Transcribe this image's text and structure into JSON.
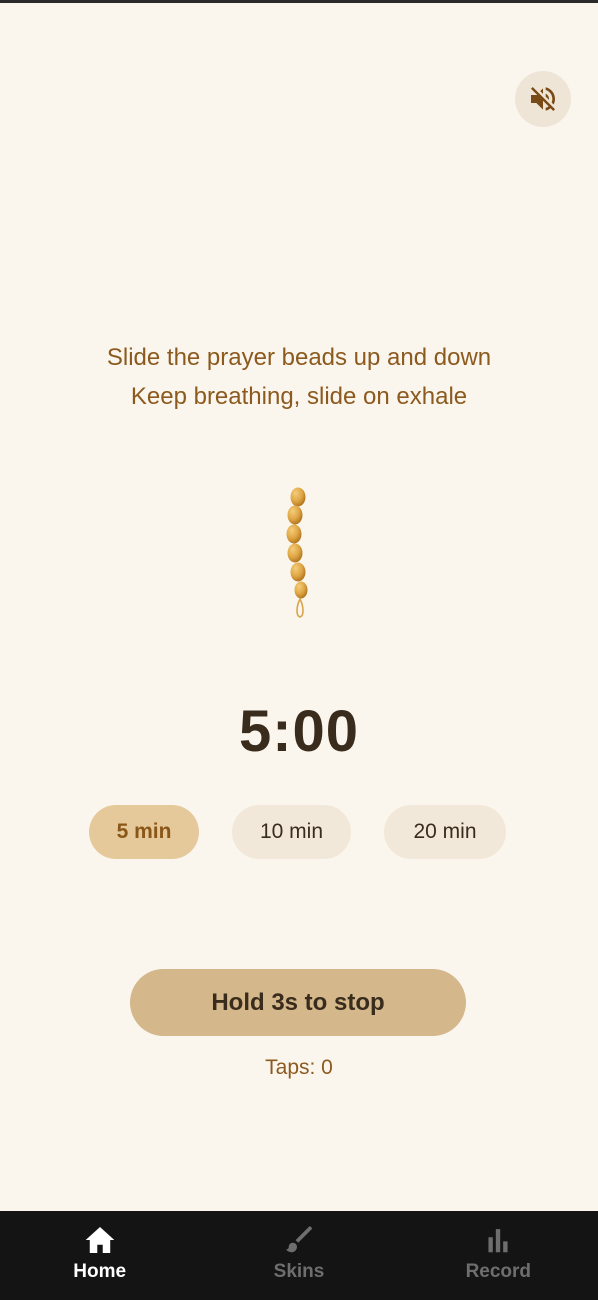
{
  "sound": {
    "icon": "speaker-muted-icon"
  },
  "instructions": {
    "line1": "Slide the prayer beads up and down",
    "line2": "Keep breathing, slide on exhale"
  },
  "timer": {
    "display": "5:00"
  },
  "durations": [
    {
      "label": "5 min",
      "selected": true
    },
    {
      "label": "10 min",
      "selected": false
    },
    {
      "label": "20 min",
      "selected": false
    }
  ],
  "stop_button": {
    "label": "Hold 3s to stop"
  },
  "taps": {
    "label": "Taps: 0"
  },
  "colors": {
    "background": "#faf6ee",
    "accent_text": "#8c5a1e",
    "bead": "#e0a645",
    "selected_chip": "#e6c99a",
    "stop_button": "#d4b78a",
    "tabbar": "#141414"
  },
  "tabbar": {
    "items": [
      {
        "label": "Home",
        "icon": "home-icon",
        "active": true
      },
      {
        "label": "Skins",
        "icon": "brush-icon",
        "active": false
      },
      {
        "label": "Record",
        "icon": "bar-chart-icon",
        "active": false
      }
    ]
  }
}
